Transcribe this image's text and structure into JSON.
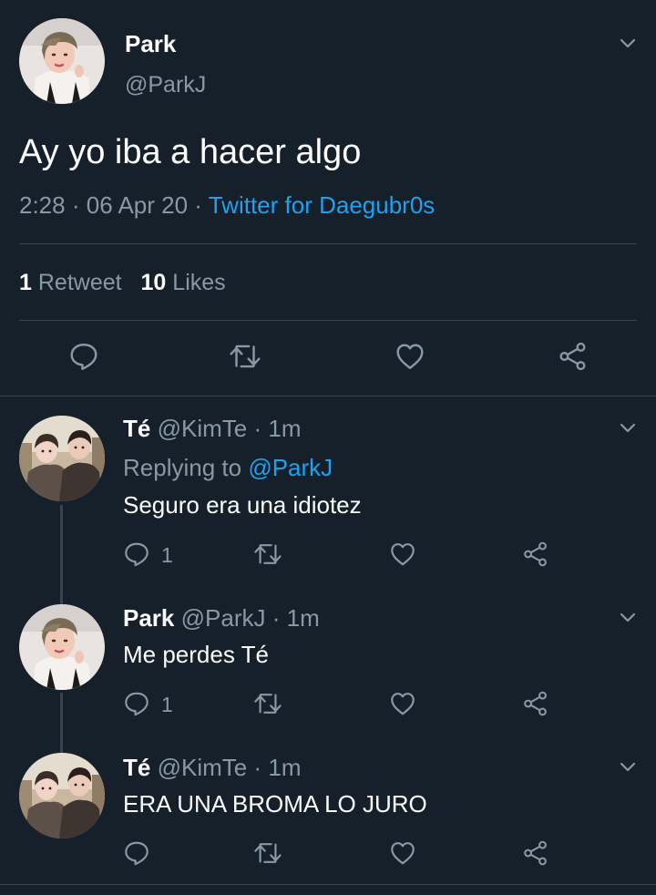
{
  "main_tweet": {
    "name": "Park",
    "handle": "@ParkJ",
    "text": "Ay yo iba a hacer algo",
    "time": "2:28",
    "date": "06 Apr 20",
    "sep1": "·",
    "sep2": "·",
    "source": "Twitter for Daegubr0s",
    "retweet_count": "1",
    "retweet_label": "Retweet",
    "likes_count": "10",
    "likes_label": "Likes"
  },
  "replies": [
    {
      "name": "Té",
      "handle": "@KimTe",
      "sep": "·",
      "time": "1m",
      "replying_label": "Replying to",
      "replying_handle": "@ParkJ",
      "text": "Seguro era una idiotez",
      "reply_count": "1"
    },
    {
      "name": "Park",
      "handle": "@ParkJ",
      "sep": "·",
      "time": "1m",
      "text": "Me perdes Té",
      "reply_count": "1"
    },
    {
      "name": "Té",
      "handle": "@KimTe",
      "sep": "·",
      "time": "1m",
      "text": "ERA UNA BROMA LO JURO",
      "reply_count": ""
    }
  ],
  "colors": {
    "background": "#15202b",
    "text": "#ffffff",
    "muted": "#8899a6",
    "link": "#1da1f2",
    "divider": "#38444d"
  },
  "icons": [
    "chevron-down-icon",
    "reply-icon",
    "retweet-icon",
    "like-icon",
    "share-icon"
  ]
}
